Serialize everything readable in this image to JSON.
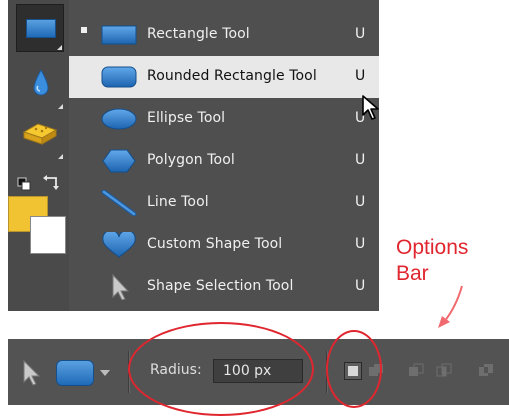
{
  "shape_menu": {
    "items": [
      {
        "label": "Rectangle Tool",
        "shortcut": "U",
        "icon": "rectangle-icon",
        "checked": true
      },
      {
        "label": "Rounded Rectangle Tool",
        "shortcut": "U",
        "icon": "rounded-rectangle-icon",
        "highlighted": true
      },
      {
        "label": "Ellipse Tool",
        "shortcut": "U",
        "icon": "ellipse-icon"
      },
      {
        "label": "Polygon Tool",
        "shortcut": "U",
        "icon": "polygon-icon"
      },
      {
        "label": "Line Tool",
        "shortcut": "U",
        "icon": "line-icon"
      },
      {
        "label": "Custom Shape Tool",
        "shortcut": "U",
        "icon": "heart-icon"
      },
      {
        "label": "Shape Selection Tool",
        "shortcut": "U",
        "icon": "arrow-cursor-icon"
      }
    ]
  },
  "colors": {
    "foreground": "#f1c232",
    "background": "#ffffff",
    "annotation": "#e0262f",
    "shape_blue": "#2f7fcf"
  },
  "annotation": {
    "line1": "Options",
    "line2": "Bar"
  },
  "options_bar": {
    "radius_label": "Radius:",
    "radius_value": "100 px"
  }
}
